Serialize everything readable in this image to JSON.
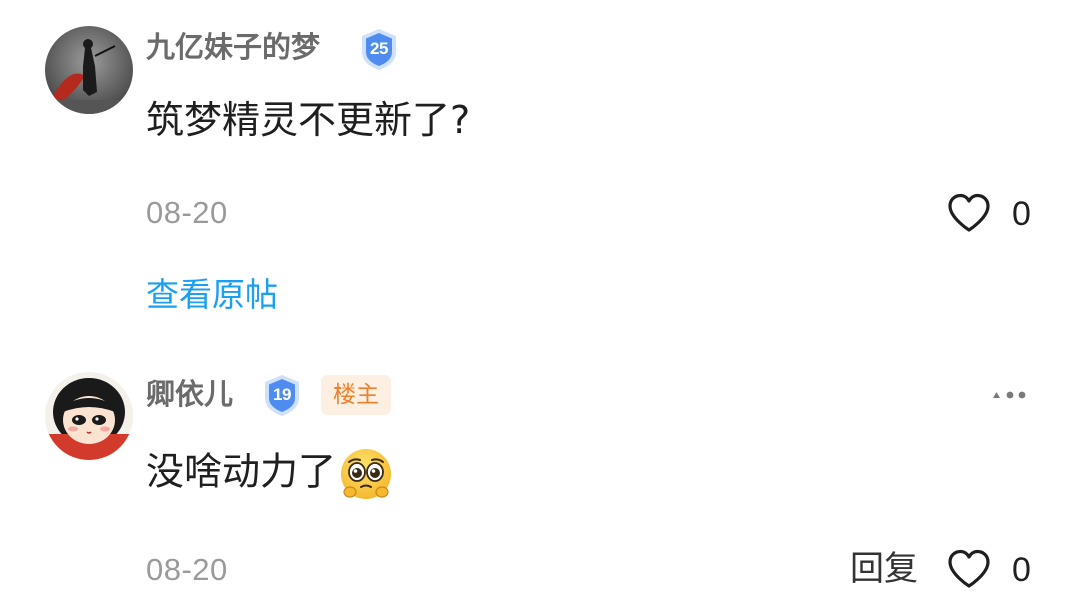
{
  "comments": [
    {
      "username": "九亿妹子的梦",
      "level": "25",
      "content": "筑梦精灵不更新了?",
      "date": "08-20",
      "like_count": "0",
      "view_post_label": "查看原帖"
    },
    {
      "username": "卿依儿",
      "level": "19",
      "owner_tag": "楼主",
      "content": "没啥动力了",
      "emoji": "pleading-face-emoji",
      "date": "08-20",
      "reply_label": "回复",
      "like_count": "0"
    }
  ],
  "colors": {
    "link_blue": "#1b9ff0",
    "owner_tag_text": "#f07f2a",
    "owner_tag_bg": "#fdf0e2",
    "badge_blue": "#4f8cf0",
    "meta_gray": "#9a9a9a"
  }
}
